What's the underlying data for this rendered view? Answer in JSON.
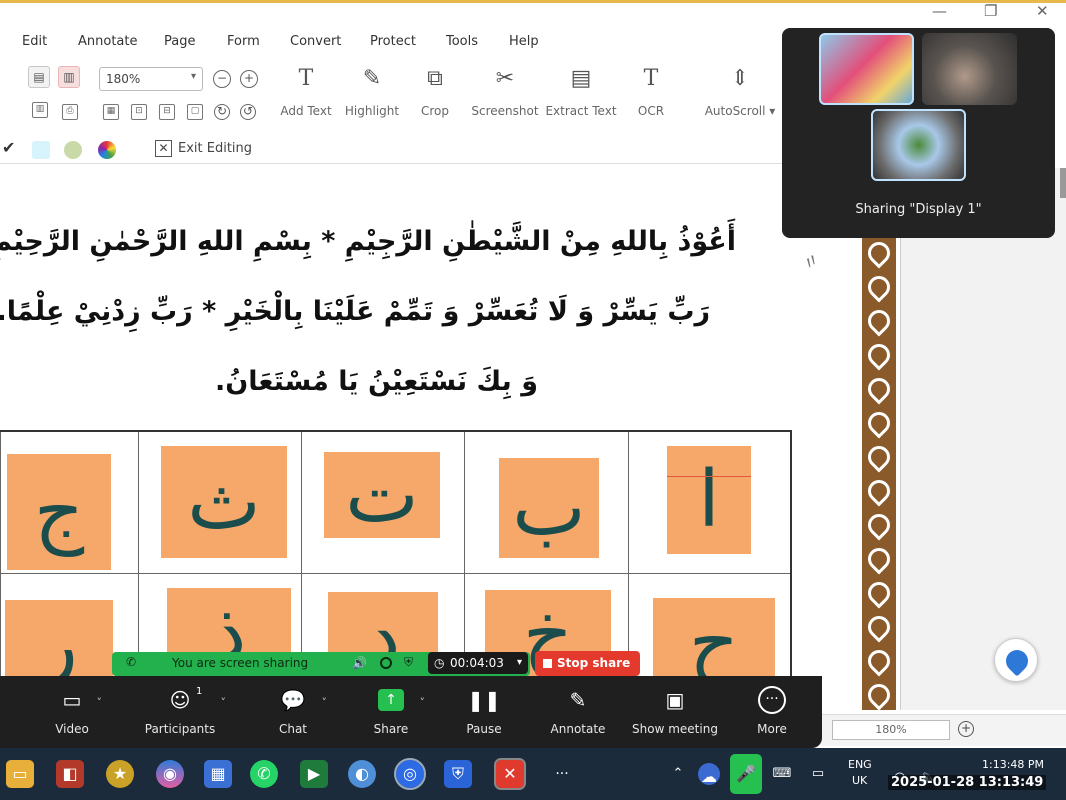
{
  "menu": {
    "items": [
      "Edit",
      "Annotate",
      "Page",
      "Form",
      "Convert",
      "Protect",
      "Tools",
      "Help"
    ]
  },
  "toolbar": {
    "zoom_value": "180%",
    "tools": [
      {
        "label": "Add Text",
        "icon": "add-text-icon",
        "glyph": "T"
      },
      {
        "label": "Highlight",
        "icon": "highlight-icon",
        "glyph": "✎"
      },
      {
        "label": "Crop",
        "icon": "crop-icon",
        "glyph": "⧉"
      },
      {
        "label": "Screenshot",
        "icon": "screenshot-icon",
        "glyph": "✂"
      },
      {
        "label": "Extract Text",
        "icon": "extract-text-icon",
        "glyph": "▤"
      },
      {
        "label": "OCR",
        "icon": "ocr-icon",
        "glyph": "T"
      },
      {
        "label": "AutoScroll ▾",
        "icon": "autoscroll-icon",
        "glyph": "⇕"
      }
    ]
  },
  "edit_strip": {
    "exit_label": "Exit Editing",
    "swatch_colors": [
      "#d7f3fb",
      "#c9d9a8"
    ]
  },
  "document": {
    "line1": "أَعُوْذُ بِاللهِ مِنْ الشَّيْطٰنِ الرَّجِيْمِ * بِسْمِ اللهِ الرَّحْمٰنِ الرَّحِيْمِ.",
    "line2": "رَبِّ يَسِّرْ وَ لَا تُعَسِّرْ وَ تَمِّمْ عَلَيْنَا بِالْخَيْرِ * رَبِّ زِدْنِيْ عِلْمًا.",
    "line3": "وَ بِكَ نَسْتَعِيْنُ يَا مُسْتَعَانُ.",
    "letters_row1": [
      "ج",
      "ث",
      "ت",
      "ب",
      "ا"
    ],
    "letters_row2": [
      "ر",
      "ذ",
      "د",
      "خ",
      "ح"
    ],
    "tile_color": "#f5a86a",
    "letter_color": "#1b4d4d"
  },
  "video_panel": {
    "sharing_label": "Sharing \"Display 1\""
  },
  "share_bar": {
    "status": "You are screen sharing",
    "timer": "00:04:03",
    "stop_label": "Stop share"
  },
  "meeting_controls": [
    {
      "label": "Video",
      "icon": "video-camera-icon",
      "glyph": "▭"
    },
    {
      "label": "Participants",
      "icon": "participants-icon",
      "glyph": "☺",
      "badge": "1"
    },
    {
      "label": "Chat",
      "icon": "chat-icon",
      "glyph": "💬"
    },
    {
      "label": "Share",
      "icon": "share-icon",
      "glyph": "↑"
    },
    {
      "label": "Pause",
      "icon": "pause-icon",
      "glyph": "❚❚"
    },
    {
      "label": "Annotate",
      "icon": "annotate-icon",
      "glyph": "✎"
    },
    {
      "label": "Show meeting",
      "icon": "show-meeting-icon",
      "glyph": "▣"
    },
    {
      "label": "More",
      "icon": "more-icon",
      "glyph": "···"
    }
  ],
  "status_bar": {
    "zoom": "180%"
  },
  "taskbar": {
    "lang_top": "ENG",
    "lang_bottom": "UK",
    "time": "1:13:48 PM",
    "datetime": "2025-01-28  13:13:49"
  }
}
